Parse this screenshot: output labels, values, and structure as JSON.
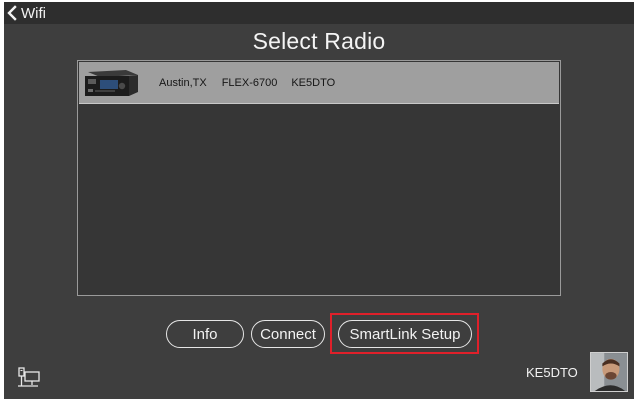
{
  "topbar": {
    "back_label": "Wifi",
    "back_icon": "chevron-left-icon"
  },
  "title": "Select Radio",
  "radios": [
    {
      "location": "Austin,TX",
      "model": "FLEX-6700",
      "callsign": "KE5DTO"
    }
  ],
  "buttons": {
    "info": "Info",
    "connect": "Connect",
    "smartlink_setup": "SmartLink Setup"
  },
  "footer": {
    "network_icon": "network-computer-icon",
    "user_callsign": "KE5DTO"
  },
  "colors": {
    "background": "#3e3e3e",
    "topbar": "#2e2e2e",
    "list_background": "#363636",
    "selected_row": "#9f9f9f",
    "highlight": "#e0202a"
  }
}
